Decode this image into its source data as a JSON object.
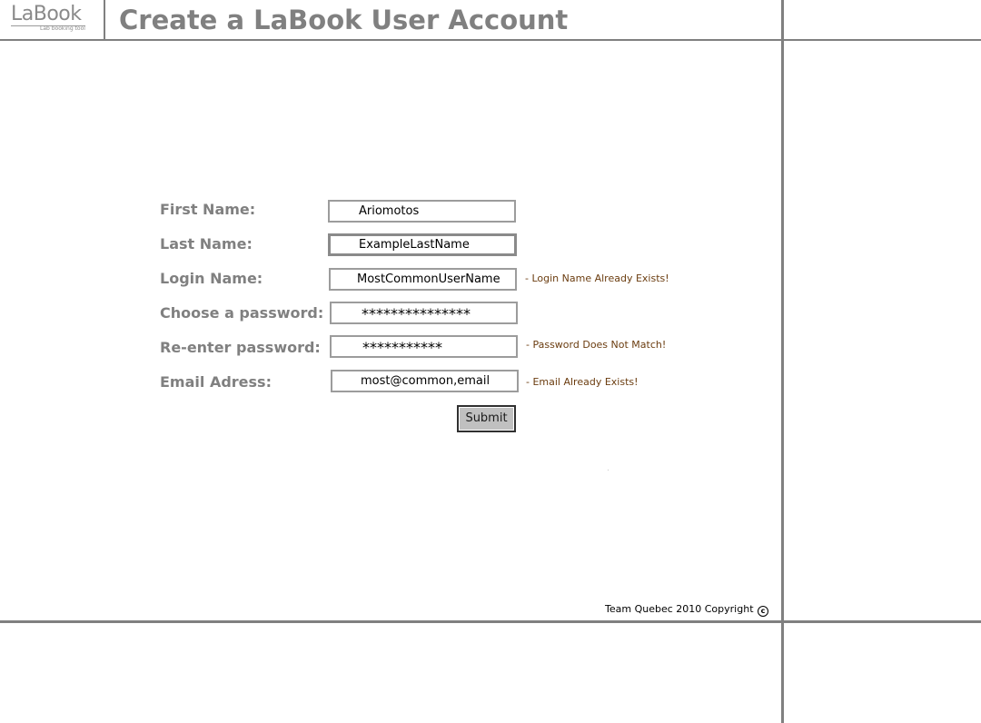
{
  "header": {
    "logo_text": "LaBook",
    "logo_tagline": "Lab booking tool",
    "title": "Create a LaBook User Account"
  },
  "form": {
    "first_name": {
      "label": "First Name:",
      "value": "Ariomotos"
    },
    "last_name": {
      "label": "Last Name:",
      "value": "ExampleLastName"
    },
    "login_name": {
      "label": "Login Name:",
      "value": "MostCommonUserName",
      "error": "- Login Name Already Exists!"
    },
    "password": {
      "label": "Choose a password:",
      "value": "***************"
    },
    "password_confirm": {
      "label": "Re-enter password:",
      "value": "***********",
      "error": "- Password Does Not Match!"
    },
    "email": {
      "label": "Email Adress:",
      "value": "most@common,email",
      "error": "- Email Already Exists!"
    },
    "submit_label": "Submit"
  },
  "footer": {
    "copyright_text": "Team Quebec 2010 Copyright",
    "copyright_icon": "copyright-icon"
  },
  "colors": {
    "frame": "#808080",
    "label": "#808080",
    "error": "#6b3d10",
    "button": "#c0c0c0"
  }
}
